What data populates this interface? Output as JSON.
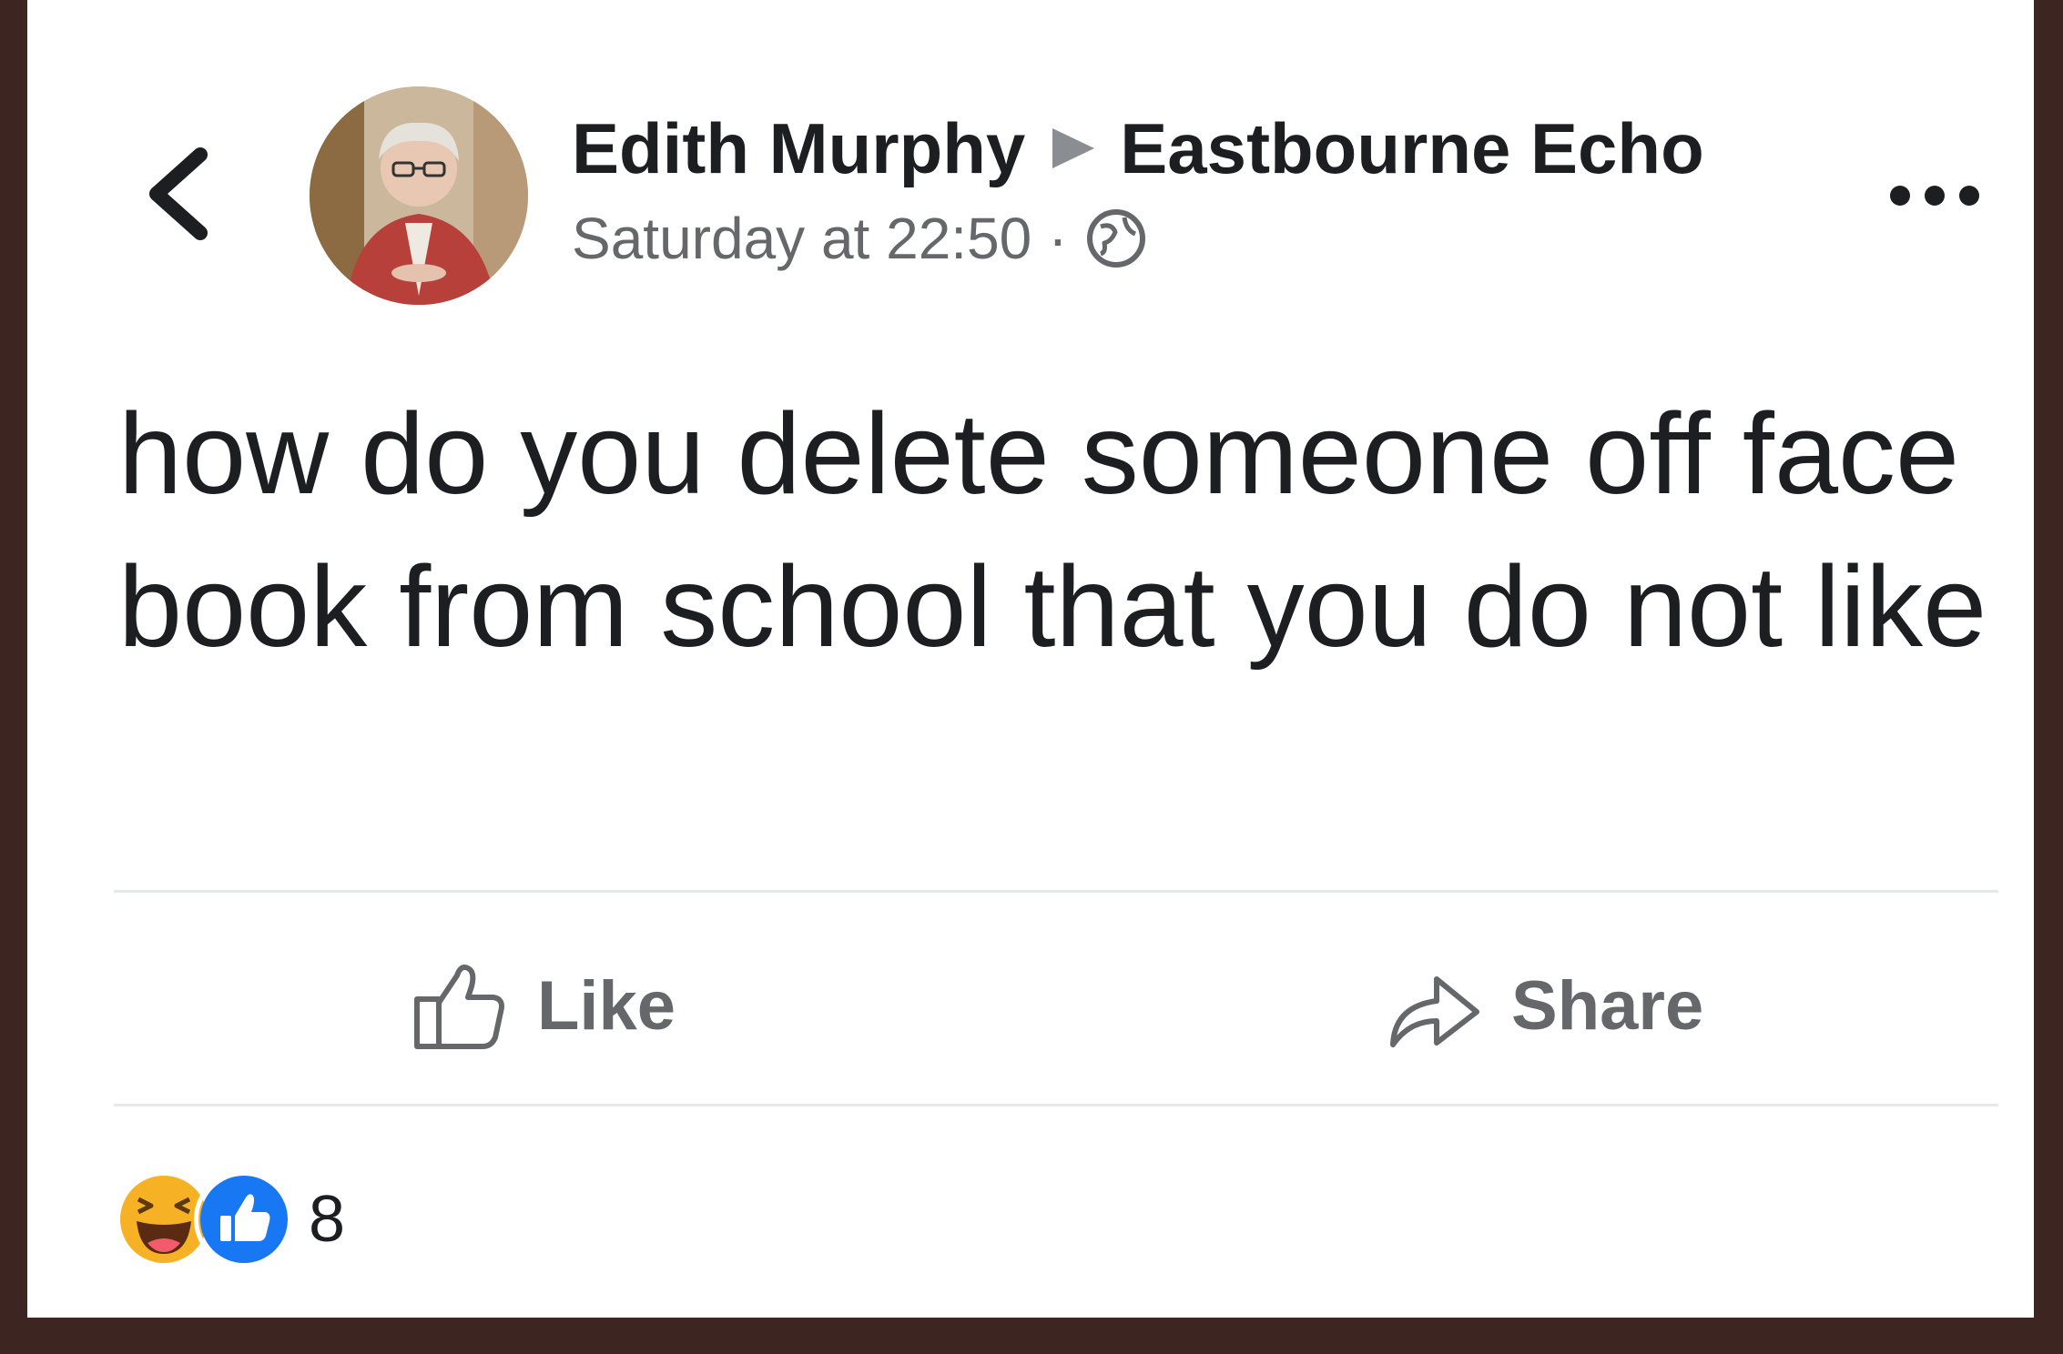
{
  "post": {
    "author": "Edith Murphy",
    "group": "Eastbourne Echo",
    "timestamp": "Saturday at 22:50",
    "separator": "·",
    "text": "how do you delete someone off face book from school that you do not like"
  },
  "actions": {
    "like_label": "Like",
    "share_label": "Share"
  },
  "reactions": {
    "count": "8",
    "types": [
      "haha-reaction-icon",
      "like-reaction-icon"
    ]
  },
  "icons": {
    "back": "chevron-left-icon",
    "arrow": "triangle-right-icon",
    "privacy": "globe-icon",
    "more": "more-dots-icon",
    "like": "thumbs-up-icon",
    "share": "share-arrow-icon"
  },
  "colors": {
    "frame": "#3d2622",
    "card": "#ffffff",
    "text_primary": "#1c1e21",
    "text_secondary": "#65676b",
    "like_blue": "#1877f2",
    "haha_yellow": "#f7b125"
  }
}
